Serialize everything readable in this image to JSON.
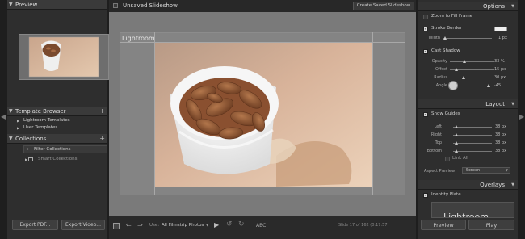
{
  "left": {
    "preview_header": "Preview",
    "template_browser_header": "Template Browser",
    "templates": [
      "Lightroom Templates",
      "User Templates"
    ],
    "collections_header": "Collections",
    "filter_collections": "Filter Collections",
    "smart_collections": "Smart Collections",
    "export_pdf_label": "Export PDF...",
    "export_video_label": "Export Video..."
  },
  "center": {
    "title": "Unsaved Slideshow",
    "create_saved_label": "Create Saved Slideshow",
    "identity_text": "Lightroom",
    "use_label": "Use:",
    "use_value": "All Filmstrip Photos",
    "abc_label": "ABC",
    "slide_status": "Slide 17 of 162 (0:17:57)"
  },
  "right": {
    "options_header": "Options",
    "zoom_fill": "Zoom to Fill Frame",
    "stroke_border": "Stroke Border",
    "width_label": "Width",
    "width_value": "1 px",
    "cast_shadow": "Cast Shadow",
    "shadow_rows": [
      {
        "label": "Opacity",
        "value": "33 %",
        "level": 0.33
      },
      {
        "label": "Offset",
        "value": "15 px",
        "level": 0.15
      },
      {
        "label": "Radius",
        "value": "30 px",
        "level": 0.3
      }
    ],
    "angle_label": "Angle",
    "angle_value": "-45",
    "layout_header": "Layout",
    "show_guides": "Show Guides",
    "guide_rows": [
      {
        "label": "Left",
        "value": "38 px"
      },
      {
        "label": "Right",
        "value": "38 px"
      },
      {
        "label": "Top",
        "value": "38 px"
      },
      {
        "label": "Bottom",
        "value": "38 px"
      }
    ],
    "link_all": "Link All",
    "aspect_label": "Aspect Preview",
    "aspect_value": "Screen",
    "overlays_header": "Overlays",
    "identity_plate": "Identity Plate",
    "preview_button": "Preview",
    "play_button": "Play"
  }
}
